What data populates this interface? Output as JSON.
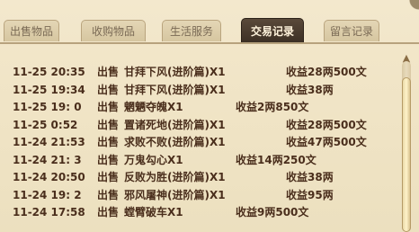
{
  "tabs": [
    {
      "label": "出售物品",
      "active": false
    },
    {
      "label": "收购物品",
      "active": false
    },
    {
      "label": "生活服务",
      "active": false
    },
    {
      "label": "交易记录",
      "active": true
    },
    {
      "label": "留言记录",
      "active": false
    }
  ],
  "records": [
    {
      "time": "11-25 20:35",
      "action": "出售",
      "item": "甘拜下风(进阶篇)X1",
      "income": "收益28两500文"
    },
    {
      "time": "11-25 19:34",
      "action": "出售",
      "item": "甘拜下风(进阶篇)X1",
      "income": "收益38两"
    },
    {
      "time": "11-25 19: 0",
      "action": "出售",
      "item": "魍魉夺魄X1",
      "income": "收益2两850文"
    },
    {
      "time": "11-25  0:52",
      "action": "出售",
      "item": "置诸死地(进阶篇)X1",
      "income": "收益28两500文"
    },
    {
      "time": "11-24 21:53",
      "action": "出售",
      "item": "求败不败(进阶篇)X1",
      "income": "收益47两500文"
    },
    {
      "time": "11-24 21: 3",
      "action": "出售",
      "item": "万鬼勾心X1",
      "income": "收益14两250文"
    },
    {
      "time": "11-24 20:50",
      "action": "出售",
      "item": "反败为胜(进阶篇)X1",
      "income": "收益38两"
    },
    {
      "time": "11-24 19: 2",
      "action": "出售",
      "item": "邪风屠神(进阶篇)X1",
      "income": "收益95两"
    },
    {
      "time": "11-24 17:58",
      "action": "出售",
      "item": "螳臂破车X1",
      "income": "收益9两500文"
    }
  ],
  "colors": {
    "accent": "#3b2f24",
    "text": "#4a2e1c",
    "panel": "#efe3c4"
  },
  "icons": {
    "scroll_up": "triangle-up-icon"
  }
}
